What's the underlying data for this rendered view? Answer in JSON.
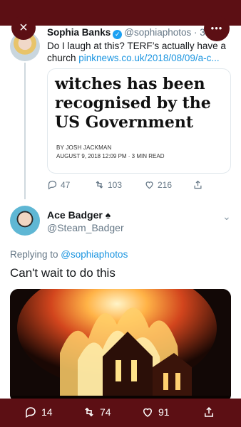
{
  "overlay": {
    "close_icon": "×",
    "more_icon": "•••"
  },
  "tweet1": {
    "name": "Sophia Banks",
    "handle": "@sophiaphotos · 3d",
    "text": "Do I laugh at this? TERF’s actually have a church ",
    "link": "pinknews.co.uk/2018/08/09/a-c...",
    "card": {
      "title": "witches has been recognised by the US Government",
      "byline": "BY JOSH JACKMAN",
      "date": "AUGUST 9, 2018 12:09 PM · 3 MIN READ"
    },
    "replies": "47",
    "retweets": "103",
    "likes": "216"
  },
  "tweet2": {
    "name": "Ace Badger",
    "name_suffix": "♠",
    "handle": "@Steam_Badger",
    "replying_prefix": "Replying to ",
    "replying_to": "@sophiaphotos",
    "text": "Can't wait to do this",
    "replies": "14",
    "retweets": "74",
    "likes": "91"
  },
  "colors": {
    "overlay": "#5c0f14",
    "link": "#1b95e0",
    "verified": "#1da1f2"
  }
}
